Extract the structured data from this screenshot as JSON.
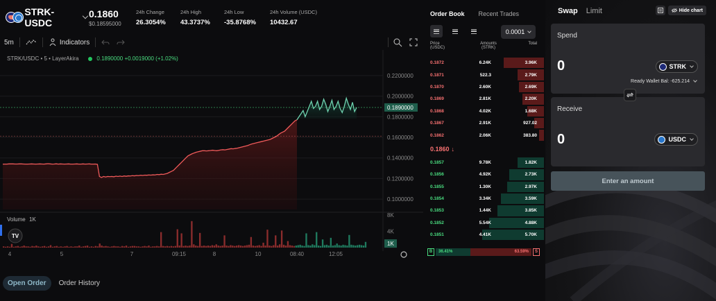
{
  "header": {
    "pair": "STRK-USDC",
    "price": "0.1860",
    "price_usd": "$0.18595000",
    "stats": [
      {
        "label": "24h Change",
        "value": "26.3054%"
      },
      {
        "label": "24h High",
        "value": "43.3737%"
      },
      {
        "label": "24h Low",
        "value": "-35.8768%"
      },
      {
        "label": "24h Volume (USDC)",
        "value": "10432.67"
      }
    ]
  },
  "toolbar": {
    "interval": "5m",
    "indicators": "Indicators"
  },
  "chart": {
    "legend_pair": "STRK/USDC • 5 • LayerAkira",
    "legend_ohlc": "0.1890000  +0.0019000 (+1.02%)",
    "volume_label": "Volume",
    "volume_value": "1K",
    "price_ticks": [
      "0.2200000",
      "0.2000000",
      "0.1800000",
      "0.1600000",
      "0.1400000",
      "0.1200000",
      "0.1000000"
    ],
    "current_price": "0.1890000",
    "volume_ticks": [
      "8K",
      "4K"
    ],
    "volume_current": "1K",
    "time_ticks": [
      "4",
      "5",
      "7",
      "09:15",
      "8",
      "10",
      "08:40",
      "12:05"
    ],
    "brand": "TV"
  },
  "chart_data": {
    "type": "area",
    "ylim": [
      0.09,
      0.23
    ],
    "y": [
      0.134,
      0.134,
      0.134,
      0.1342,
      0.1342,
      0.1342,
      0.1341,
      0.1341,
      0.1342,
      0.1342,
      0.1341,
      0.134,
      0.134,
      0.1341,
      0.1342,
      0.1341,
      0.134,
      0.1341,
      0.1342,
      0.1341,
      0.134,
      0.1342,
      0.1344,
      0.1342,
      0.134,
      0.1341,
      0.1343,
      0.134,
      0.1342,
      0.1341,
      0.134,
      0.1341,
      0.1342,
      0.134,
      0.134,
      0.1341,
      0.1342,
      0.134,
      0.134,
      0.1342,
      0.134,
      0.1341,
      0.1342,
      0.134,
      0.134,
      0.1341,
      0.1338,
      0.122,
      0.121,
      0.122,
      0.1215,
      0.122,
      0.1218,
      0.122,
      0.1217,
      0.1223,
      0.122,
      0.1224,
      0.122,
      0.1225,
      0.1222,
      0.1226,
      0.1225,
      0.1228,
      0.1226,
      0.123,
      0.1228,
      0.1232,
      0.123,
      0.1233,
      0.1232,
      0.1235,
      0.1233,
      0.1236,
      0.1235,
      0.124,
      0.1238,
      0.1242,
      0.124,
      0.1245,
      0.125,
      0.126,
      0.127,
      0.128,
      0.13,
      0.132,
      0.134,
      0.136,
      0.138,
      0.14,
      0.142,
      0.143,
      0.144,
      0.1448,
      0.1455,
      0.146,
      0.1465,
      0.147,
      0.147,
      0.1468,
      0.147,
      0.1472,
      0.1475,
      0.1472,
      0.147,
      0.1474,
      0.1478,
      0.148,
      0.1478,
      0.1482,
      0.1486,
      0.149,
      0.1488,
      0.1492,
      0.1495,
      0.15,
      0.1505,
      0.151,
      0.1515,
      0.152,
      0.1528,
      0.1535,
      0.154,
      0.1545,
      0.155,
      0.1555,
      0.156,
      0.1565,
      0.157,
      0.1575,
      0.158,
      0.159,
      0.16,
      0.161,
      0.1625,
      0.164,
      0.165,
      0.166,
      0.168,
      0.17,
      0.172,
      0.174,
      0.176,
      0.177,
      0.18,
      0.183,
      0.186,
      0.18,
      0.185,
      0.19,
      0.195,
      0.188,
      0.19,
      0.195,
      0.187,
      0.19,
      0.197,
      0.192,
      0.185,
      0.19,
      0.196,
      0.187,
      0.19,
      0.195,
      0.188,
      0.184,
      0.19,
      0.198,
      0.192,
      0.187,
      0.194,
      0.185,
      0.189
    ],
    "volume": [
      0.3,
      0.2,
      0.3,
      0.2,
      0.9,
      0.2,
      0.3,
      0.4,
      0.2,
      0.3,
      0.5,
      0.3,
      0.3,
      0.2,
      0.4,
      0.3,
      0.5,
      0.3,
      0.2,
      0.3,
      0.4,
      0.2,
      0.3,
      0.6,
      0.2,
      0.3,
      0.4,
      0.2,
      0.3,
      0.2,
      0.3,
      0.4,
      0.2,
      0.3,
      0.2,
      0.3,
      0.3,
      0.5,
      0.2,
      0.3,
      0.4,
      0.5,
      0.2,
      0.3,
      0.2,
      0.4,
      0.3,
      1.0,
      0.5,
      0.3,
      0.4,
      0.3,
      0.2,
      0.3,
      0.4,
      0.3,
      0.3,
      0.2,
      0.4,
      0.3,
      0.5,
      0.2,
      0.3,
      0.4,
      0.4,
      0.3,
      0.3,
      0.2,
      0.3,
      0.4,
      0.3,
      0.5,
      0.2,
      0.3,
      0.3,
      0.4,
      0.3,
      3.8,
      0.4,
      0.3,
      0.4,
      0.3,
      0.4,
      0.3,
      0.4,
      4.5,
      0.5,
      3.5,
      0.4,
      0.5,
      0.4,
      0.5,
      6.5,
      0.8,
      0.5,
      0.4,
      3.6,
      0.4,
      0.5,
      0.4,
      0.5,
      0.4,
      0.6,
      0.5,
      0.8,
      0.5,
      0.4,
      0.5,
      3.0,
      0.5,
      0.4,
      0.6,
      0.5,
      0.4,
      0.5,
      0.6,
      0.5,
      0.4,
      0.5,
      0.6,
      0.7,
      2.6,
      0.5,
      0.4,
      0.5,
      0.6,
      0.4,
      1.2,
      0.5,
      4.4,
      0.5,
      0.4,
      0.6,
      3.0,
      0.5,
      0.8,
      4.2,
      0.7,
      0.5,
      1.6,
      0.6,
      0.5,
      0.4,
      0.5,
      0.6,
      0.7,
      0.5,
      0.4,
      3.5,
      0.6,
      0.5,
      0.8,
      0.6,
      3.8,
      0.5,
      0.4,
      2.0,
      0.6,
      0.7,
      0.5,
      2.4,
      0.5,
      0.6,
      1.0,
      0.6,
      0.5,
      0.7,
      0.6,
      0.5,
      3.1,
      0.7,
      0.6,
      0.5,
      0.6,
      0.7,
      0.6,
      0.5,
      1.4
    ],
    "volume_ylim": [
      0,
      8
    ]
  },
  "orderbook": {
    "tabs": [
      "Order Book",
      "Recent Trades"
    ],
    "tick": "0.0001",
    "col_price": "Price (USDC)",
    "col_amount": "Amounts (STRK)",
    "col_total": "Total",
    "asks": [
      {
        "price": "0.1872",
        "amount": "6.24K",
        "total": "3.96K",
        "depth": 0.34
      },
      {
        "price": "0.1871",
        "amount": "522.3",
        "total": "2.79K",
        "depth": 0.22
      },
      {
        "price": "0.1870",
        "amount": "2.60K",
        "total": "2.69K",
        "depth": 0.21
      },
      {
        "price": "0.1869",
        "amount": "2.81K",
        "total": "2.20K",
        "depth": 0.18
      },
      {
        "price": "0.1868",
        "amount": "4.02K",
        "total": "1.68K",
        "depth": 0.14
      },
      {
        "price": "0.1867",
        "amount": "2.91K",
        "total": "927.02",
        "depth": 0.08
      },
      {
        "price": "0.1862",
        "amount": "2.06K",
        "total": "383.80",
        "depth": 0.04
      }
    ],
    "mid_price": "0.1860",
    "bids": [
      {
        "price": "0.1857",
        "amount": "9.78K",
        "total": "1.82K",
        "depth": 0.22
      },
      {
        "price": "0.1856",
        "amount": "4.92K",
        "total": "2.73K",
        "depth": 0.29
      },
      {
        "price": "0.1855",
        "amount": "1.30K",
        "total": "2.97K",
        "depth": 0.31
      },
      {
        "price": "0.1854",
        "amount": "3.34K",
        "total": "3.59K",
        "depth": 0.36
      },
      {
        "price": "0.1853",
        "amount": "1.44K",
        "total": "3.85K",
        "depth": 0.39
      },
      {
        "price": "0.1852",
        "amount": "5.54K",
        "total": "4.88K",
        "depth": 0.46
      },
      {
        "price": "0.1851",
        "amount": "4.41K",
        "total": "5.70K",
        "depth": 0.52
      }
    ],
    "buy_pct": "36.41%",
    "sell_pct": "63.59%",
    "buy_ratio": 0.3641,
    "buy_label": "B",
    "sell_label": "S"
  },
  "bottom_tabs": [
    "Open Order",
    "Order History"
  ],
  "swap": {
    "tabs": [
      "Swap",
      "Limit"
    ],
    "hide_chart": "Hide chart",
    "spend_title": "Spend",
    "spend_amount": "0",
    "spend_token": "STRK",
    "wallet_bal": "Ready Wallet Bal: -625.214",
    "receive_title": "Receive",
    "receive_amount": "0",
    "receive_token": "USDC",
    "enter_amount": "Enter an amount"
  },
  "colors": {
    "up": "#4ade80",
    "down": "#f87171",
    "line_low": "#f05a5a",
    "line_high": "#6fd3b0",
    "accent": "#47535a"
  }
}
